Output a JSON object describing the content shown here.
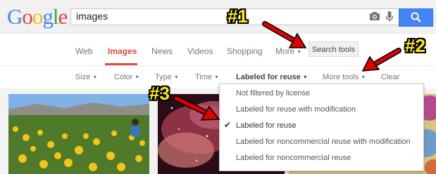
{
  "logo": {
    "letters": [
      "G",
      "o",
      "o",
      "g",
      "l",
      "e"
    ],
    "colors": [
      "#4285f4",
      "#ea4335",
      "#fbbc05",
      "#4285f4",
      "#34a853",
      "#ea4335"
    ]
  },
  "search": {
    "query": "images",
    "camera_icon": "camera-icon",
    "mic_icon": "microphone-icon",
    "button_icon": "magnifier-icon"
  },
  "nav": {
    "web": "Web",
    "images": "Images",
    "news": "News",
    "videos": "Videos",
    "shopping": "Shopping",
    "more": "More",
    "search_tools": "Search tools"
  },
  "tools": {
    "size": "Size",
    "color": "Color",
    "type": "Type",
    "time": "Time",
    "labeled_for_reuse": "Labeled for reuse",
    "more_tools": "More tools",
    "clear": "Clear"
  },
  "usage_menu": {
    "items": [
      "Not filtered by license",
      "Labeled for reuse with modification",
      "Labeled for reuse",
      "Labeled for noncommercial reuse with modification",
      "Labeled for noncommercial reuse"
    ],
    "selected_index": 2
  },
  "annotations": {
    "one": "#1",
    "two": "#2",
    "three": "#3",
    "color": "#ffea00",
    "arrow_color": "#e00000"
  }
}
